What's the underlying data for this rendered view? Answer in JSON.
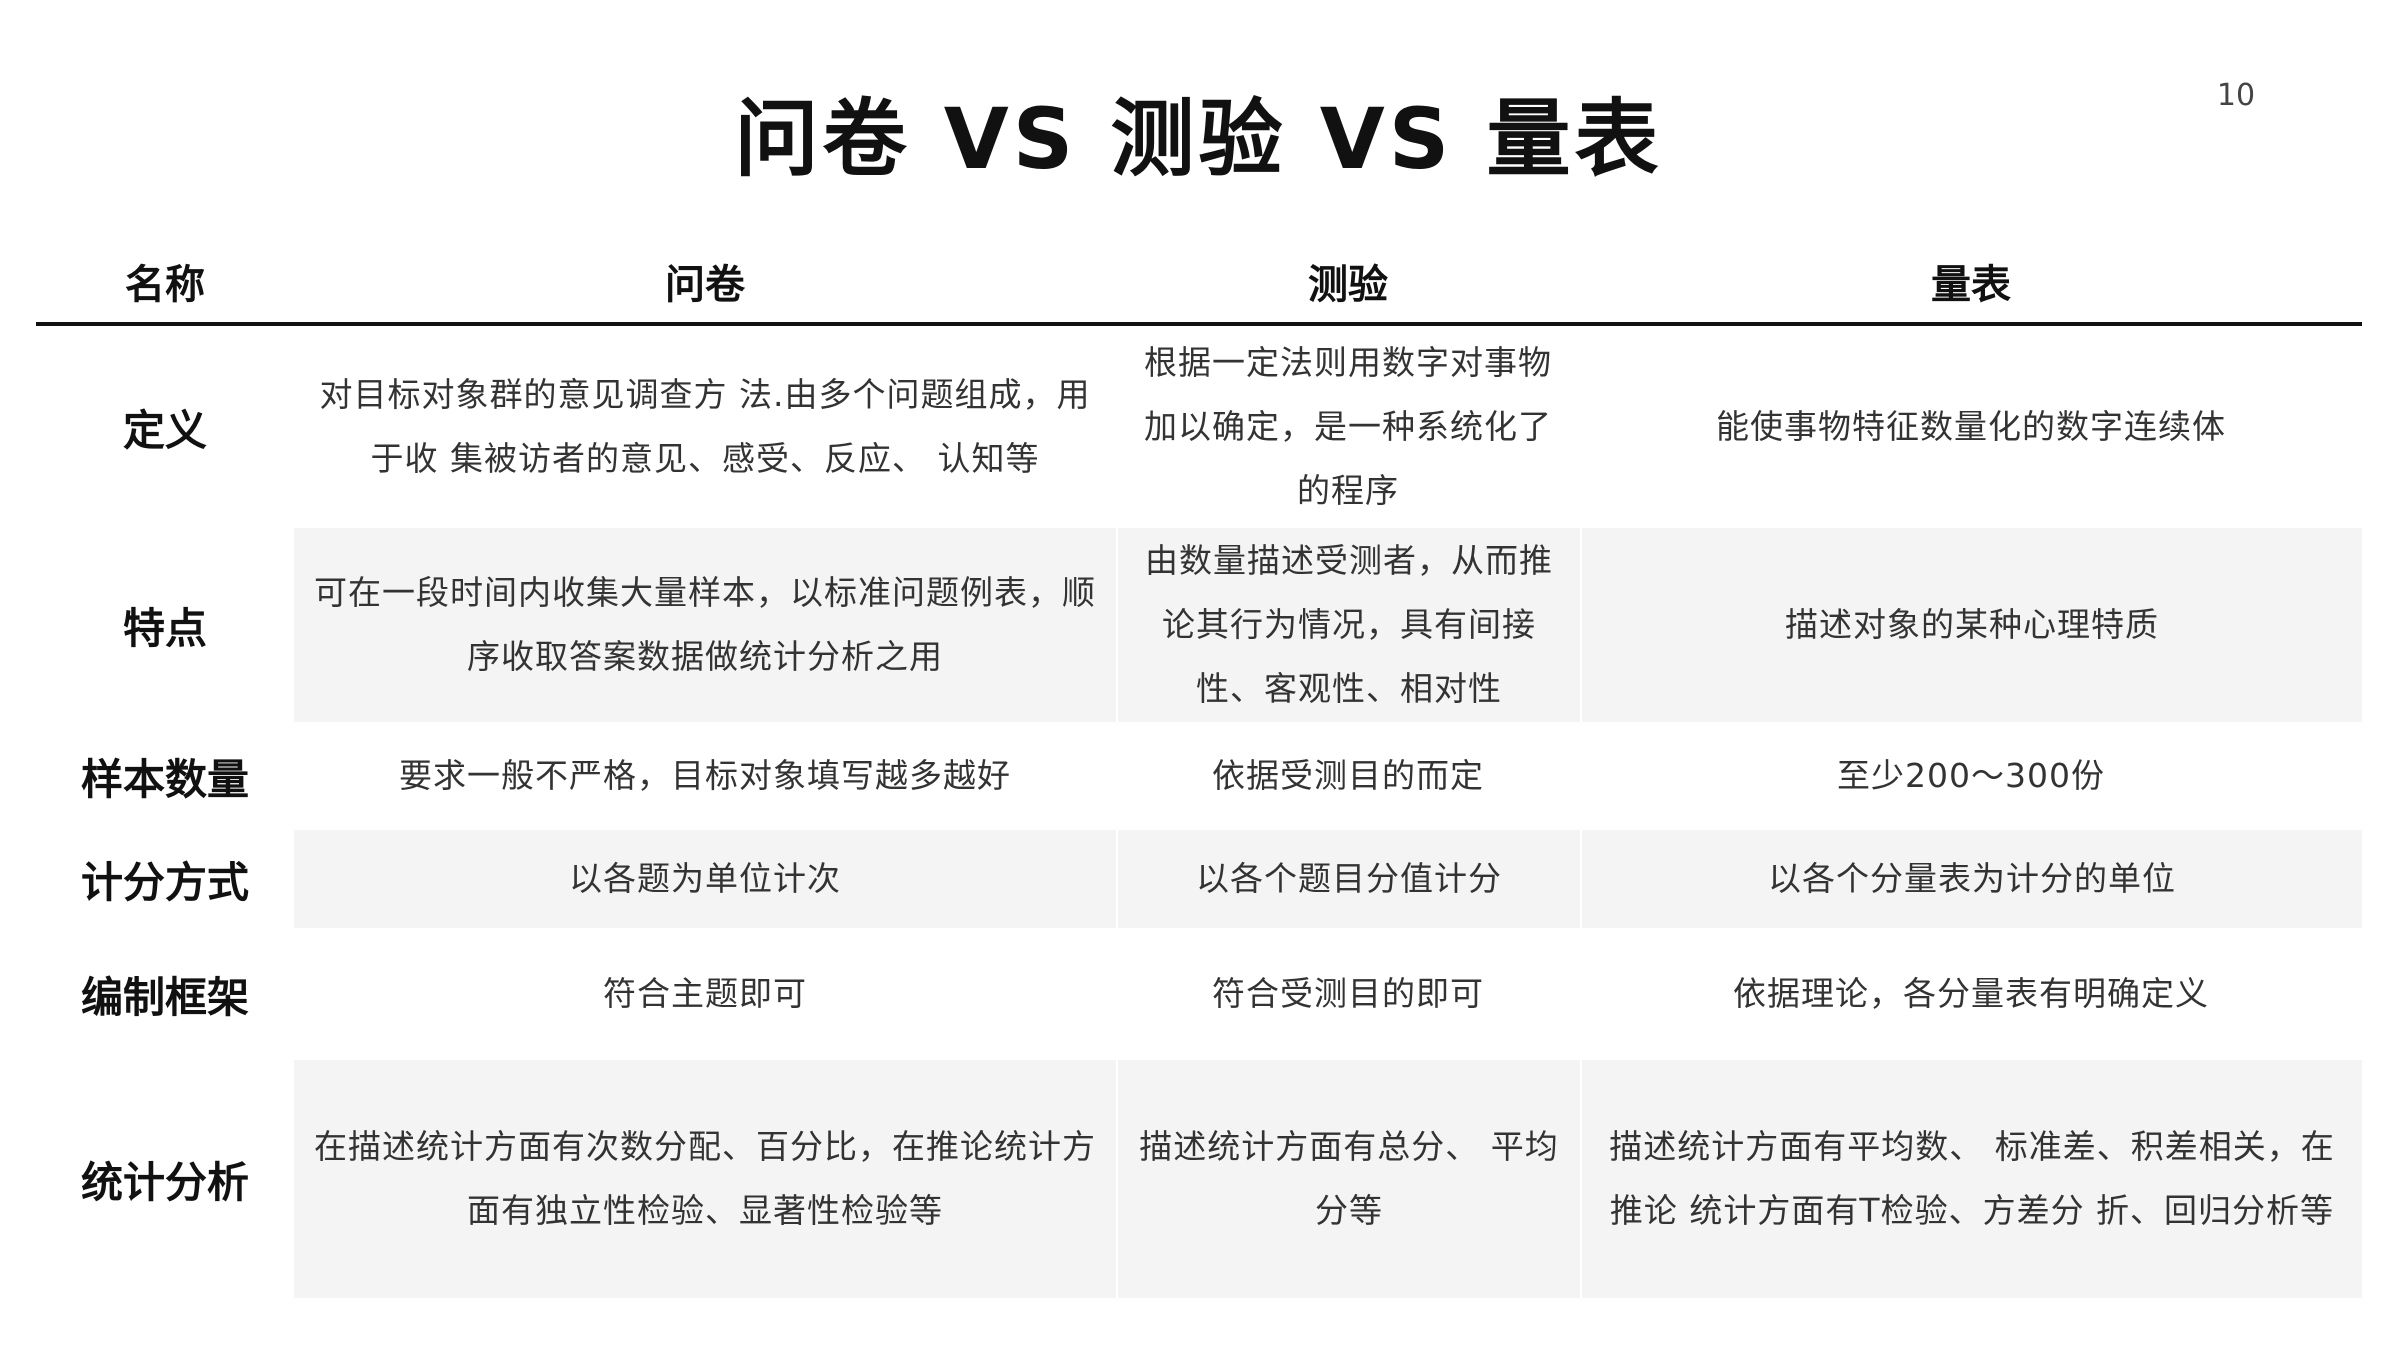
{
  "page_number": "10",
  "title": "问卷 VS 测验 VS 量表",
  "table": {
    "headers": [
      "名称",
      "问卷",
      "测验",
      "量表"
    ],
    "rows": [
      {
        "name": "定义",
        "questionnaire": "对目标对象群的意见调查方 法.由多个问题组成，用于收 集被访者的意见、感受、反应、 认知等",
        "test": "根据一定法则用数字对事物加以确定，是一种系统化了的程序",
        "scale": "能使事物特征数量化的数字连续体"
      },
      {
        "name": "特点",
        "questionnaire": "可在一段时间内收集大量样本，以标准问题例表，顺序收取答案数据做统计分析之用",
        "test": "由数量描述受测者，从而推论其行为情况，具有间接性、客观性、相对性",
        "scale": "描述对象的某种心理特质"
      },
      {
        "name": "样本数量",
        "questionnaire": "要求一般不严格，目标对象填写越多越好",
        "test": "依据受测目的而定",
        "scale": "至少200～300份"
      },
      {
        "name": "计分方式",
        "questionnaire": "以各题为单位计次",
        "test": "以各个题目分值计分",
        "scale": "以各个分量表为计分的单位"
      },
      {
        "name": "编制框架",
        "questionnaire": "符合主题即可",
        "test": "符合受测目的即可",
        "scale": "依据理论，各分量表有明确定义"
      },
      {
        "name": "统计分析",
        "questionnaire": "在描述统计方面有次数分配、百分比，在推论统计方面有独立性检验、显著性检验等",
        "test": "描述统计方面有总分、 平均分等",
        "scale": "描述统计方面有平均数、 标准差、积差相关，在推论 统计方面有T检验、方差分 折、回归分析等"
      }
    ]
  },
  "colors": {
    "row_shade": "#f4f4f4",
    "rule": "#111111"
  }
}
